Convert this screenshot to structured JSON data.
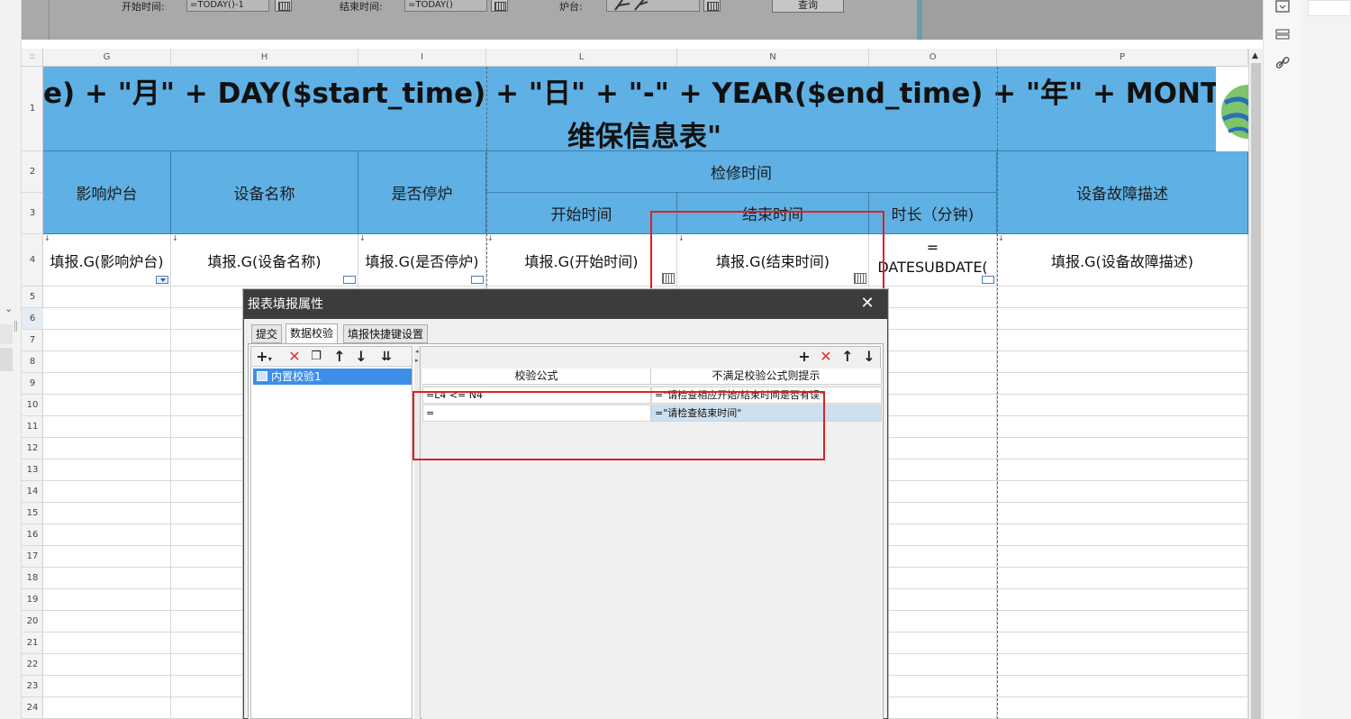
{
  "param_bar": {
    "start_label": "开始时间:",
    "start_value": "=TODAY()-1",
    "end_label": "结束时间:",
    "end_value": "=TODAY()",
    "furnace_label": "炉台:",
    "query_button": "查询"
  },
  "columns": [
    "G",
    "H",
    "I",
    "L",
    "N",
    "O",
    "P"
  ],
  "rows": [
    "1",
    "2",
    "3",
    "4",
    "5",
    "6",
    "7",
    "8",
    "9",
    "10",
    "11",
    "12",
    "13",
    "14",
    "15",
    "16",
    "17",
    "18",
    "19",
    "20",
    "21",
    "22",
    "23",
    "24"
  ],
  "report": {
    "title_line1": "e) + \"月\" + DAY($start_time) + \"日\" + \"-\" + YEAR($end_time) + \"年\" + MONTH(",
    "title_line2": "维保信息表\"",
    "headers": {
      "affected_furnace": "影响炉台",
      "device_name": "设备名称",
      "is_stopped": "是否停炉",
      "repair_time": "检修时间",
      "start_time": "开始时间",
      "end_time": "结束时间",
      "duration": "时长（分钟)",
      "fault_desc": "设备故障描述"
    },
    "data_row": {
      "affected_furnace": "填报.G(影响炉台)",
      "device_name": "填报.G(设备名称)",
      "is_stopped": "填报.G(是否停炉)",
      "start_time": "填报.G(开始时间)",
      "end_time": "填报.G(结束时间)",
      "duration_line1": "=",
      "duration_line2": "DATESUBDATE(",
      "fault_desc": "填报.G(设备故障描述)"
    }
  },
  "dialog": {
    "title": "报表填报属性",
    "tabs": [
      "提交",
      "数据校验",
      "填报快捷键设置"
    ],
    "active_tab": "数据校验",
    "tree_items": [
      "内置校验1"
    ],
    "table": {
      "headers": [
        "校验公式",
        "不满足校验公式则提示"
      ],
      "rows": [
        {
          "formula": "=L4 <= N4",
          "message": "=\"请检查相应开始/结束时间是否有误\""
        },
        {
          "formula": "=",
          "message": "=\"请检查结束时间\""
        }
      ]
    }
  },
  "colors": {
    "header_blue": "#5fb0e4",
    "highlight_red": "#e02020",
    "dialog_title_bg": "#3c3c3c",
    "selected_tree_bg": "#3d8ee8"
  }
}
